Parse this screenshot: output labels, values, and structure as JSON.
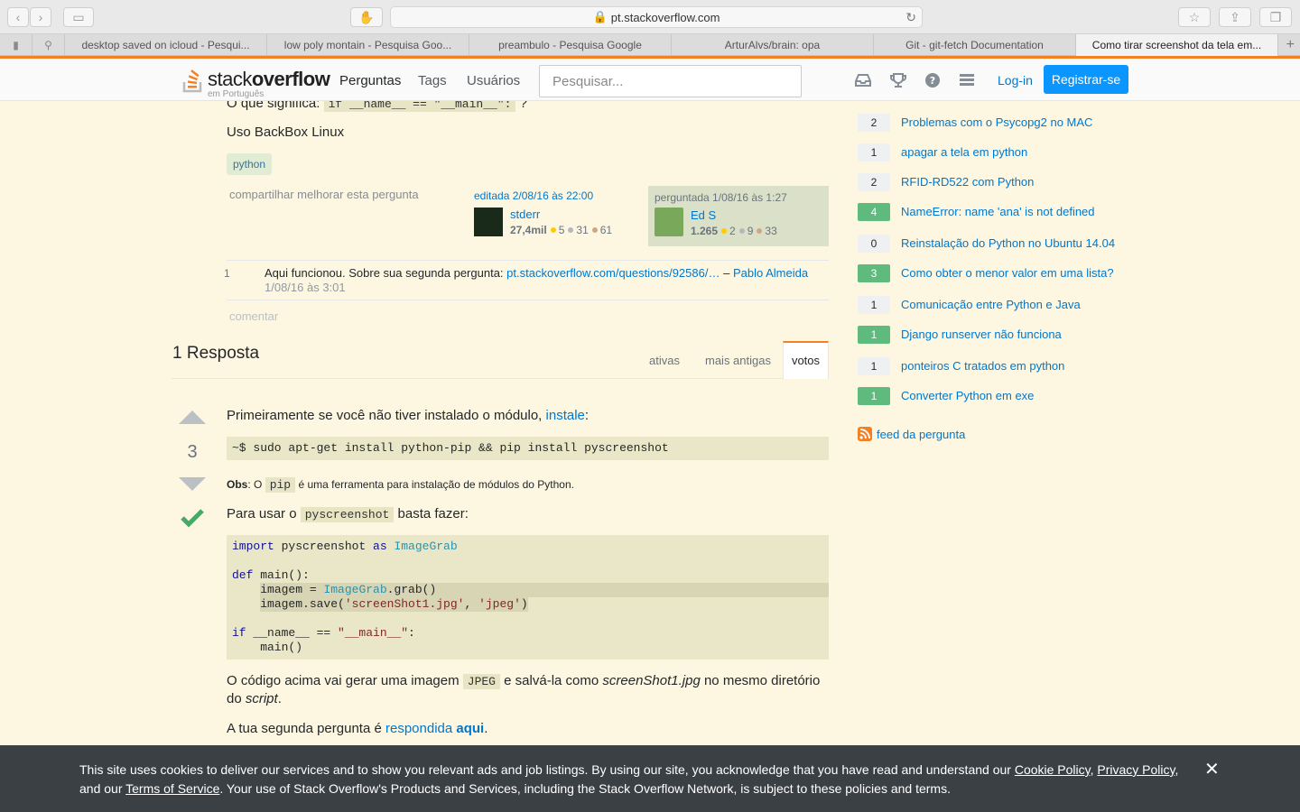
{
  "browser": {
    "url": "pt.stackoverflow.com",
    "tabs": [
      "desktop saved on icloud - Pesqui...",
      "low poly montain - Pesquisa Goo...",
      "preambulo - Pesquisa Google",
      "ArturAlvs/brain: opa",
      "Git - git-fetch Documentation",
      "Como tirar screenshot da tela em..."
    ]
  },
  "header": {
    "logo_stack": "stack",
    "logo_overflow": "overflow",
    "logo_sub": "em Português",
    "nav": [
      "Perguntas",
      "Tags",
      "Usuários"
    ],
    "search_placeholder": "Pesquisar...",
    "login": "Log-in",
    "register": "Registrar-se",
    "accent_color": "#f48024"
  },
  "question": {
    "top_line_prefix": "O que significa:",
    "top_line_code": "if __name__ == \"__main__\":",
    "top_line_suffix": "?",
    "backbox": "Uso BackBox Linux",
    "tag": "python",
    "links": "compartilhar  melhorar esta pergunta",
    "edited": {
      "label": "editada 2/08/16 às 22:00",
      "user": "stderr",
      "rep": "27,4mil",
      "gold": "5",
      "silver": "31",
      "bronze": "61"
    },
    "asked": {
      "label": "perguntada 1/08/16 às 1:27",
      "user": "Ed S",
      "rep": "1.265",
      "gold": "2",
      "silver": "9",
      "bronze": "33"
    },
    "comment": {
      "score": "1",
      "text": "Aqui funcionou. Sobre sua segunda pergunta:",
      "link": "pt.stackoverflow.com/questions/92586/…",
      "dash": "–",
      "author": "Pablo Almeida",
      "date": "1/08/16 às 3:01"
    },
    "add_comment": "comentar"
  },
  "answers": {
    "title": "1 Resposta",
    "sort_tabs": [
      "ativas",
      "mais antigas",
      "votos"
    ],
    "active_sort": "votos"
  },
  "answer": {
    "votes": "3",
    "accepted": true,
    "p1_text": "Primeiramente se você não tiver instalado o módulo,",
    "p1_link": "instale",
    "p1_end": ":",
    "install_cmd": "~$ sudo apt-get install python-pip && pip install pyscreenshot",
    "obs_label": "Obs",
    "obs_mid": ": O",
    "obs_code": "pip",
    "obs_rest": "é uma ferramenta para instalação de módulos do Python.",
    "p2_before": "Para usar o",
    "p2_code": "pyscreenshot",
    "p2_after": "basta fazer:",
    "code_lines": [
      "import pyscreenshot as ImageGrab",
      "",
      "def main():",
      "    imagem = ImageGrab.grab()",
      "    imagem.save('screenShot1.jpg', 'jpeg')",
      "",
      "if __name__ == \"__main__\":",
      "    main()"
    ],
    "p3_a": "O código acima vai gerar uma imagem",
    "p3_code": "JPEG",
    "p3_b": "e salvá-la como",
    "p3_em": "screenShot1.jpg",
    "p3_c": "no mesmo diretório do",
    "p3_em2": "script",
    "p3_d": ".",
    "p4_a": "A tua segunda pergunta é",
    "p4_link1": "respondida",
    "p4_link2": "aqui",
    "p4_end": "."
  },
  "related": [
    {
      "score": "2",
      "title": "Problemas com o Psycopg2 no MAC",
      "answered": false
    },
    {
      "score": "1",
      "title": "apagar a tela em python",
      "answered": false
    },
    {
      "score": "2",
      "title": "RFID-RD522 com Python",
      "answered": false
    },
    {
      "score": "4",
      "title": "NameError: name 'ana' is not defined",
      "answered": true
    },
    {
      "score": "0",
      "title": "Reinstalação do Python no Ubuntu 14.04",
      "answered": false
    },
    {
      "score": "3",
      "title": "Como obter o menor valor em uma lista?",
      "answered": true
    },
    {
      "score": "1",
      "title": "Comunicação entre Python e Java",
      "answered": false
    },
    {
      "score": "1",
      "title": "Django runserver não funciona",
      "answered": true
    },
    {
      "score": "1",
      "title": "ponteiros C tratados em python",
      "answered": false
    },
    {
      "score": "1",
      "title": "Converter Python em exe",
      "answered": true
    }
  ],
  "feed": "feed da pergunta",
  "cookie": {
    "text_1": "This site uses cookies to deliver our services and to show you relevant ads and job listings. By using our site, you acknowledge that you have read and understand our",
    "cookie_policy": "Cookie Policy",
    "comma": ",",
    "privacy_policy": "Privacy Policy",
    "and_our": ", and our",
    "terms": "Terms of Service",
    "text_2": ". Your use of Stack Overflow's Products and Services, including the Stack Overflow Network, is subject to these policies and terms.",
    "close": "✕"
  }
}
